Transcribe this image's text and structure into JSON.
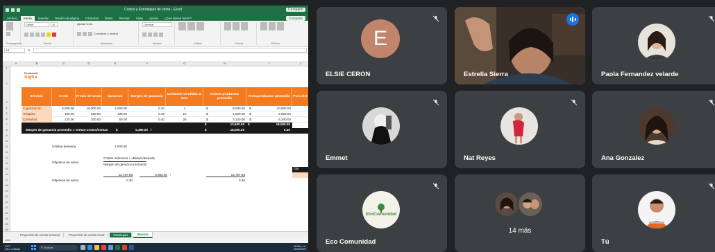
{
  "excel": {
    "title": "Costos y Estrategias de venta - Excel",
    "user": "Compartir",
    "tabs": [
      "Archivo",
      "Inicio",
      "Insertar",
      "Diseño de página",
      "Fórmulas",
      "Datos",
      "Revisar",
      "Vista",
      "Ayuda",
      "¿Qué desea hacer?"
    ],
    "active_tab": "Inicio",
    "share_label": "Compartir",
    "ribbon_groups": [
      "Portapapeles",
      "Fuente",
      "Alineación",
      "Número",
      "Estilos",
      "Celdas",
      "Edición"
    ],
    "font_name": "Calibri",
    "font_size": "11",
    "number_format": "General",
    "wrap_label": "Ajustar texto",
    "merge_label": "Combinar y centrar",
    "name_box": "A1",
    "formula_fx": "fx",
    "columns": [
      "A",
      "B",
      "C",
      "D",
      "E",
      "F",
      "G",
      "H",
      "I",
      "J"
    ],
    "rows": [
      "1",
      "2",
      "3",
      "4",
      "5",
      "6",
      "7",
      "8",
      "9",
      "10",
      "11",
      "12",
      "13",
      "14",
      "15",
      "16",
      "17",
      "18",
      "19",
      "20",
      "21",
      "22",
      "23",
      "24",
      "25",
      "26"
    ],
    "logo_top": "Restaurante",
    "logo_name": "Sigfra",
    "headers": [
      "Servicio",
      "Costo",
      "Precio de venta",
      "Ganancia",
      "Margen de ganancia",
      "Unidades vendidas al mes",
      "Costos productos promedio",
      "Venta productos promedio",
      "Porc dist"
    ],
    "table_rows": [
      {
        "servicio": "Capacitación",
        "costo": "8,000.00",
        "precio": "10,000.00",
        "ganancia": "2,000.00",
        "margen": "0.20",
        "unidades": "1",
        "cur1": "$",
        "costos_prom": "8,000.00",
        "cur2": "$",
        "venta_prom": "10,000.00"
      },
      {
        "servicio": "Terapias",
        "costo": "150.00",
        "precio": "280.00",
        "ganancia": "130.00",
        "margen": "0.46",
        "unidades": "10",
        "cur1": "$",
        "costos_prom": "1,500.00",
        "cur2": "$",
        "venta_prom": "2,800.00"
      },
      {
        "servicio": "Consultas",
        "costo": "120.00",
        "precio": "200.00",
        "ganancia": "80.00",
        "margen": "0.40",
        "unidades": "26",
        "cur1": "$",
        "costos_prom": "3,120.00",
        "cur2": "$",
        "venta_prom": "5,200.00"
      }
    ],
    "totals": {
      "cur1": "$",
      "costos": "12,620.00",
      "cur2": "$",
      "venta": "18,000.00"
    },
    "row7": {
      "label": "Margen de ganancia promedio = ventas-costos/ventas",
      "cur": "$",
      "value": "5,380.00",
      "slash": "/",
      "cur2": "$",
      "value2": "18,000.00",
      "result": "0.30"
    },
    "utilidad_label": "Utilidad deseada",
    "utilidad_value": "3,000.00",
    "objetivos_label": "Objetivos de venta",
    "formula_top": "Costos indirectos + utilidad deseada",
    "formula_bottom": "Margen de ganancia promedio",
    "calc1": "12,757.98",
    "calc2": "3,000.00",
    "plus": "+",
    "calc_result": "15,757.98",
    "objetivos_label2": "Objetivos de venta",
    "margin_val1": "0.30",
    "margin_val2": "0.30",
    "side_box": "Obj",
    "sheet_tabs": [
      "Proyección de ventas semanal",
      "Proyección de ventas anual",
      "Estrategias",
      "Servicio"
    ],
    "status_text": "Listo",
    "taskbar": {
      "weather_temp": "19°C",
      "weather_desc": "Parc. nublado",
      "search": "Buscar",
      "time": "08:56 p. m.",
      "date": "16/09/2022"
    }
  },
  "participants": [
    {
      "name": "ELSIE CERON",
      "initial": "E",
      "avatar_color": "#c0856a",
      "muted": true
    },
    {
      "name": "Estrella Sierra",
      "speaking": true
    },
    {
      "name": "Paola Fernandez velarde",
      "muted": true
    },
    {
      "name": "Emmet",
      "muted": true
    },
    {
      "name": "Nat Reyes",
      "muted": true
    },
    {
      "name": "Ana Gonzalez",
      "muted": true
    },
    {
      "name": "Eco Comunidad",
      "logo_text": "EcoComunidad",
      "muted": true
    },
    {
      "name": "14 más"
    },
    {
      "name": "Tú",
      "muted": true
    }
  ],
  "colors": {
    "excel_green": "#1e7145",
    "header_orange": "#f47b20",
    "tile_bg": "#3c4043",
    "page_bg": "#202124",
    "speaking_blue": "#1a73e8"
  }
}
